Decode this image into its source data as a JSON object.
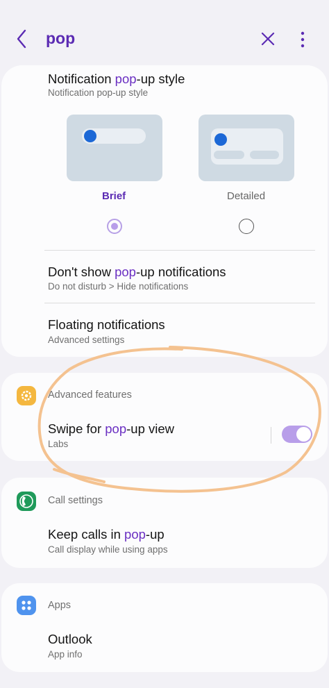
{
  "header": {
    "search_query": "pop"
  },
  "popup_style": {
    "title_before": "Notification ",
    "title_highlight": "pop",
    "title_after": "-up style",
    "subtitle": "Notification pop-up style",
    "option_brief": "Brief",
    "option_detailed": "Detailed",
    "selected": "Brief"
  },
  "dont_show": {
    "title_before": "Don't show ",
    "title_highlight": "pop",
    "title_after": "-up notifications",
    "subtitle": "Do not disturb > Hide notifications"
  },
  "floating": {
    "title": "Floating notifications",
    "subtitle": "Advanced settings"
  },
  "advanced_features": {
    "section": "Advanced features",
    "swipe_title_before": "Swipe for ",
    "swipe_title_highlight": "pop",
    "swipe_title_after": "-up view",
    "swipe_subtitle": "Labs",
    "swipe_enabled": true
  },
  "call_settings": {
    "section": "Call settings",
    "title_before": "Keep calls in ",
    "title_highlight": "pop",
    "title_after": "-up",
    "subtitle": "Call display while using apps"
  },
  "apps": {
    "section": "Apps",
    "title": "Outlook",
    "subtitle": "App info"
  },
  "colors": {
    "accent": "#6a2fc2",
    "toggle_on": "#b89ee9",
    "annotation": "#f4c290",
    "advanced_badge": "#f4b73f",
    "call_badge": "#1f9a5a",
    "apps_badge": "#4f93ee"
  },
  "icons": {
    "back": "chevron-left-icon",
    "clear": "close-icon",
    "more": "more-vertical-icon",
    "advanced": "gear-badge-icon",
    "call": "phone-badge-icon",
    "apps": "apps-grid-badge-icon"
  }
}
